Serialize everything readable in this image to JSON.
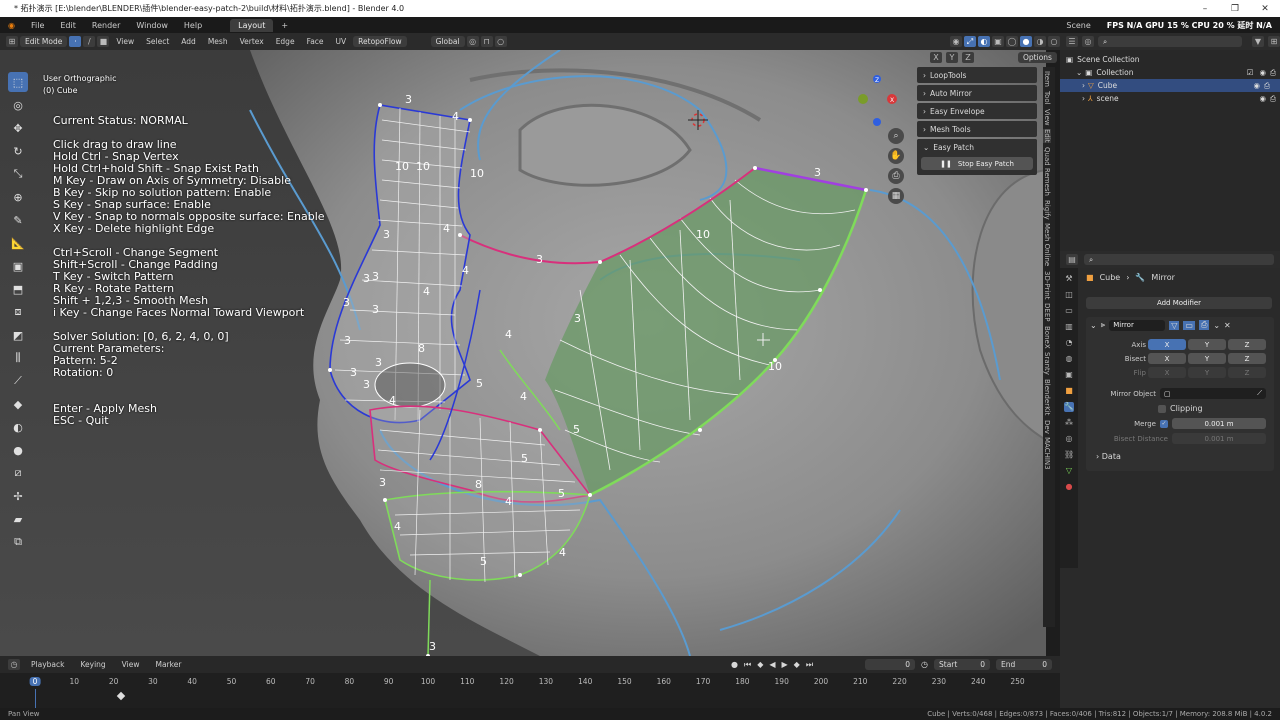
{
  "window": {
    "title": "* 拓扑演示 [E:\\blender\\BLENDER\\插件\\blender-easy-patch-2\\build\\材料\\拓扑演示.blend] - Blender 4.0",
    "minimize": "–",
    "maximize": "❐",
    "close": "✕"
  },
  "menubar": {
    "items": [
      "File",
      "Edit",
      "Render",
      "Window",
      "Help"
    ],
    "workspace_tab": "Layout",
    "add_tab": "+",
    "scene_label": "Scene",
    "fps_stats": "FPS N/A GPU 15 % CPU 20 % 延时 N/A"
  },
  "viewport_header": {
    "mode": "Edit Mode",
    "menus": [
      "View",
      "Select",
      "Add",
      "Mesh",
      "Vertex",
      "Edge",
      "Face",
      "UV"
    ],
    "addon_menu": "RetopoFlow",
    "orientation": "Global",
    "options_label": "Options"
  },
  "viewport_info": {
    "view_name": "User Orthographic",
    "object_name": "(0) Cube"
  },
  "overlay": {
    "status": "Current Status: NORMAL",
    "help_lines": [
      "Click drag to draw line",
      "Hold Ctrl - Snap Vertex",
      "Hold Ctrl+hold Shift - Snap Exist Path",
      "M Key - Draw on Axis of Symmetry: Disable",
      "B Key - Skip no solution pattern: Enable",
      "S Key - Snap surface: Enable",
      "V Key - Snap to normals opposite surface: Enable",
      "X Key - Delete highlight Edge"
    ],
    "control_lines": [
      "Ctrl+Scroll - Change Segment",
      "Shift+Scroll - Change Padding",
      "T Key - Switch Pattern",
      "R Key - Rotate Pattern",
      "Shift + 1,2,3 - Smooth Mesh",
      "i Key - Change Faces Normal Toward Viewport"
    ],
    "solver_lines": [
      "Solver Solution: [0, 6, 2, 4, 0, 0]",
      "Current Parameters:",
      "Pattern: 5-2",
      "Rotation: 0"
    ],
    "exit_lines": [
      "Enter - Apply Mesh",
      "ESC - Quit"
    ]
  },
  "segment_labels": [
    "3",
    "4",
    "10",
    "10",
    "10",
    "3",
    "3",
    "4",
    "3",
    "4",
    "3",
    "4",
    "3",
    "3",
    "8",
    "4",
    "3",
    "3",
    "5",
    "4",
    "4",
    "5",
    "8",
    "3",
    "5",
    "3",
    "4",
    "5",
    "4",
    "5",
    "3",
    "3",
    "10",
    "10",
    "3",
    "4",
    "3"
  ],
  "npanel": {
    "panels": [
      "LoopTools",
      "Auto Mirror",
      "Easy Envelope",
      "Mesh Tools",
      "Easy Patch"
    ],
    "stop_button": "Stop Easy Patch",
    "vertical_tabs": [
      "Item",
      "Tool",
      "View",
      "Edit",
      "Quad Remesh",
      "Rigify",
      "Mesh Online",
      "3D-Print",
      "DEEP",
      "BoneX",
      "Sranty",
      "BlenderKit",
      "Dev",
      "MACHIN3"
    ],
    "axis_letters": [
      "X",
      "Y",
      "Z"
    ]
  },
  "outliner": {
    "rows": [
      "Scene Collection",
      "Collection",
      "Cube",
      "scene"
    ]
  },
  "properties": {
    "breadcrumb": [
      "Cube",
      "Mirror"
    ],
    "add_modifier": "Add Modifier",
    "modifier_name": "Mirror",
    "axis_label": "Axis",
    "bisect_label": "Bisect",
    "flip_label": "Flip",
    "xyz": [
      "X",
      "Y",
      "Z"
    ],
    "mirror_object_label": "Mirror Object",
    "clipping_label": "Clipping",
    "merge_label": "Merge",
    "merge_value": "0.001 m",
    "bisect_distance_label": "Bisect Distance",
    "bisect_distance_value": "0.001 m",
    "data_label": "Data"
  },
  "timeline": {
    "menus": [
      "Playback",
      "Keying",
      "View",
      "Marker"
    ],
    "current_frame": "0",
    "start_label": "Start",
    "start_value": "0",
    "end_label": "End",
    "end_value": "0",
    "ruler_ticks": [
      "0",
      "10",
      "20",
      "30",
      "40",
      "50",
      "60",
      "70",
      "80",
      "90",
      "100",
      "110",
      "120",
      "130",
      "140",
      "150",
      "160",
      "170",
      "180",
      "190",
      "200",
      "210",
      "220",
      "230",
      "240",
      "250"
    ]
  },
  "statusbar": {
    "left": "Pan View",
    "right": "Cube | Verts:0/468 | Edges:0/873 | Faces:0/406 | Tris:812 | Objects:1/7 | Memory: 208.8 MiB | 4.0.2"
  },
  "colors": {
    "accent": "#4772b3",
    "patch_fill": "#6a9a66",
    "edge_green": "#7fdb5a",
    "edge_blue": "#2a39d6",
    "edge_pink": "#d8307c",
    "edge_red": "#e03030",
    "guide_blue": "#5a9bd0"
  }
}
